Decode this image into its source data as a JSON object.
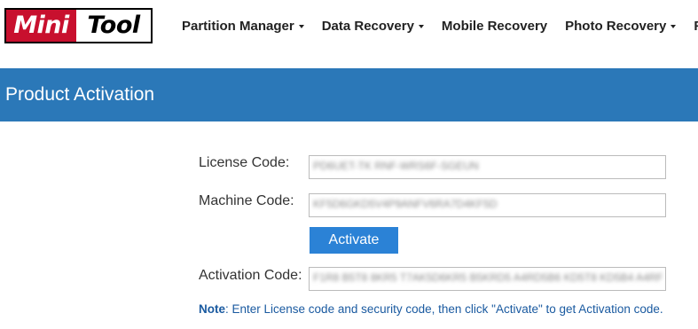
{
  "header": {
    "logo": {
      "left": "Mini",
      "right": "Tool"
    },
    "nav": [
      {
        "label": "Partition Manager",
        "dropdown": true
      },
      {
        "label": "Data Recovery",
        "dropdown": true
      },
      {
        "label": "Mobile Recovery",
        "dropdown": false
      },
      {
        "label": "Photo Recovery",
        "dropdown": true
      },
      {
        "label": "Fr",
        "dropdown": false
      }
    ]
  },
  "title": "Product Activation",
  "form": {
    "license_label": "License Code:",
    "license_value": "PD6UET-TK RNF-WRS6F-SGEUN",
    "machine_label": "Machine Code:",
    "machine_value": "KF5D6GKD5V4P9ANFV6RA7D4KF5D",
    "activate_label": "Activate",
    "activation_label": "Activation Code:",
    "activation_value": "F1R8 B5T8 8KR5 T7AK5D6KR5 B5KRD5 A4RD5B6 KD5T8 KD5B4 A4RF"
  },
  "note": {
    "prefix": "Note",
    "text": ": Enter License code and security code, then click \"Activate\" to get Activation code."
  },
  "colors": {
    "band": "#2b78b8",
    "button": "#2b82d6",
    "logo_red": "#c8102e",
    "note": "#1a5aa0"
  }
}
